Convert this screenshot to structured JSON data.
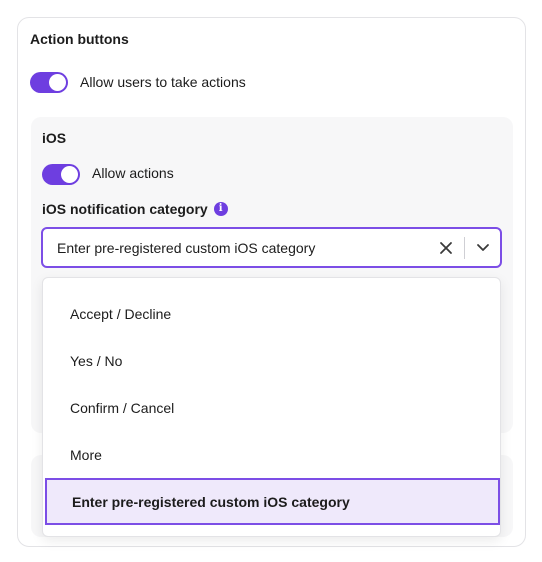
{
  "card": {
    "title": "Action buttons"
  },
  "global_toggle": {
    "label": "Allow users to take actions",
    "on": true
  },
  "ios": {
    "title": "iOS",
    "toggle": {
      "label": "Allow actions",
      "on": true
    },
    "category": {
      "label": "iOS notification category",
      "info_icon": "info-icon",
      "selected_value": "Enter pre-registered custom iOS category",
      "options": [
        "Accept / Decline",
        "Yes / No",
        "Confirm / Cancel",
        "More",
        "Enter pre-registered custom iOS category"
      ],
      "selected_index": 4
    }
  },
  "colors": {
    "accent": "#6e3ee0",
    "selected_bg": "#efe9fb",
    "panel_bg": "#f7f7f8"
  }
}
